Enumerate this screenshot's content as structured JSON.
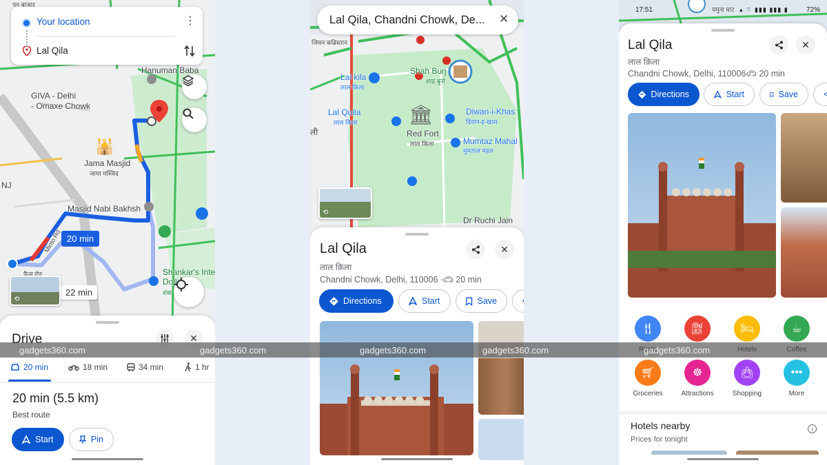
{
  "watermark": "gadgets360.com",
  "screen1": {
    "from_label": "Your location",
    "to_label": "Lal Qila",
    "map_labels": {
      "top_bazar": "पन बाजार",
      "hanuman": "Hanuman Baba",
      "giva": "GIVA - Delhi\n- Omaxe Chowk",
      "jama": "Jama Masjid",
      "jama_hi": "जामा मस्जिद",
      "nabi": "Masjid Nabi Bakhsh",
      "nj": "NJ",
      "minto": "Minto Rd",
      "faiz": "फ़ैज़ रोड",
      "shankar": "Shankar's Inte",
      "dolls": "Doll",
      "shankar_hi": "शंक"
    },
    "route_fast_label": "20 min",
    "route_alt_label": "22 min",
    "sheet_title": "Drive",
    "modes": [
      {
        "icon": "car-icon",
        "label": "20 min"
      },
      {
        "icon": "motorbike-icon",
        "label": "18 min"
      },
      {
        "icon": "transit-icon",
        "label": "34 min"
      },
      {
        "icon": "walk-icon",
        "label": "1 hr"
      }
    ],
    "summary": "20 min (5.5 km)",
    "sub": "Best route",
    "start_label": "Start",
    "pin_label": "Pin"
  },
  "screen2": {
    "search_text": "Lal Qila, Chandni Chowk, De...",
    "map_labels": {
      "hindi_top": "जियन कब्रिस्तान",
      "shahburj": "Shah Burj",
      "shahburj_hi": "शाह बुर्ज",
      "lalkila": "Lal kila",
      "lalkila_hi": "लाल किला",
      "lalquila": "Lal Quila",
      "lalquila_hi": "लाल किला",
      "redfort": "Red Fort",
      "redfort_hi": "लाल किला",
      "diwan": "Diwan-i-Khas",
      "diwan_hi": "दिवान-इ-खास",
      "mumtaz": "Mumtaz Mahal",
      "mumtaz_hi": "मुमताज़ महल",
      "ruchi": "Dr Ruchi Jain",
      "edge": "ली"
    },
    "place_title": "Lal Qila",
    "place_hindi": "लाल क़िला",
    "address": "Chandni Chowk, Delhi, 110006 ·",
    "drive_time": "20 min",
    "directions_label": "Directions",
    "start_label": "Start",
    "save_label": "Save"
  },
  "screen3": {
    "status_time": "17:51",
    "status_map": "यमुना घाट",
    "battery": "72%",
    "place_title": "Lal Qila",
    "place_hindi": "लाल क़िला",
    "address": "Chandni Chowk, Delhi, 110006 ·",
    "drive_time": "20 min",
    "directions_label": "Directions",
    "start_label": "Start",
    "save_label": "Save",
    "categories": [
      {
        "name": "restaurants",
        "label": "Resta",
        "icon": "fork-knife-icon",
        "color": "#4285f4"
      },
      {
        "name": "gas",
        "label": "",
        "icon": "fuel-icon",
        "color": "#ea4335"
      },
      {
        "name": "hotels",
        "label": "Hotels",
        "icon": "bed-icon",
        "color": "#fbbc04"
      },
      {
        "name": "coffee",
        "label": "Coffee",
        "icon": "coffee-icon",
        "color": "#34a853"
      },
      {
        "name": "groceries",
        "label": "Groceries",
        "icon": "cart-icon",
        "color": "#fa7b17"
      },
      {
        "name": "attractions",
        "label": "Attractions",
        "icon": "ferris-wheel-icon",
        "color": "#e52592"
      },
      {
        "name": "shopping",
        "label": "Shopping",
        "icon": "bag-icon",
        "color": "#a142f4"
      },
      {
        "name": "more",
        "label": "More",
        "icon": "more-icon",
        "color": "#24c1e0"
      }
    ],
    "hotels_title": "Hotels nearby",
    "hotels_sub": "Prices for tonight"
  }
}
